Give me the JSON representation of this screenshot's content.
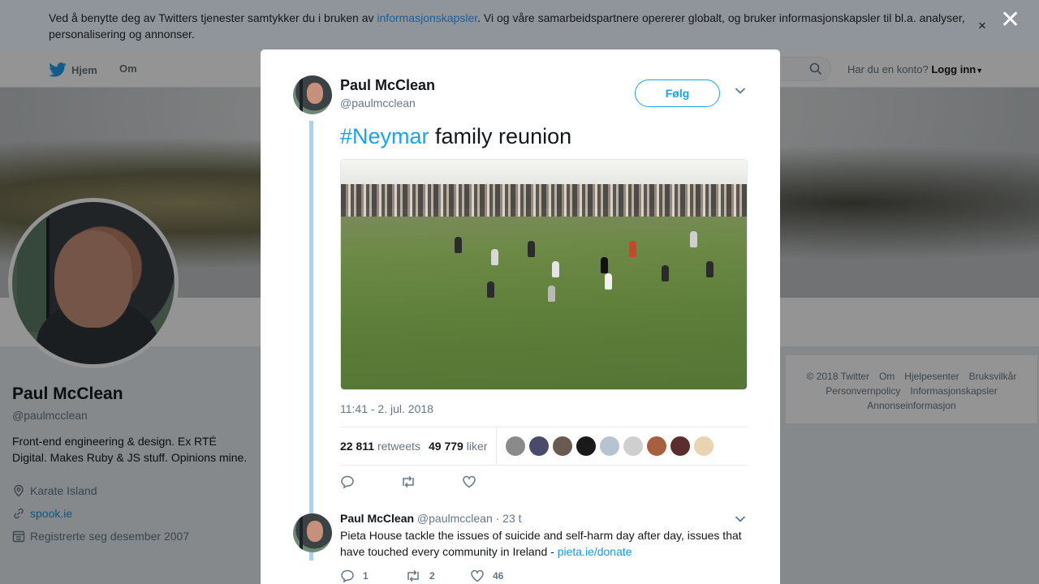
{
  "cookie": {
    "text_before": "Ved å benytte deg av Twitters tjenester samtykker du i bruken av ",
    "link": "informasjonskapsler",
    "text_after": ". Vi og våre samarbeidspartnere opererer globalt, og bruker informasjonskapsler til bl.a. analyser, personalisering og annonser.",
    "close_glyph": "×"
  },
  "overlay": {
    "close_glyph": "✕"
  },
  "nav": {
    "home": "Hjem",
    "about": "Om",
    "account_prompt": "Har du en konto?",
    "login": "Logg inn"
  },
  "profile": {
    "name": "Paul McClean",
    "handle": "@paulmcclean",
    "bio": "Front-end engineering & design. Ex RTÉ Digital. Makes Ruby & JS stuff. Opinions mine.",
    "location": "Karate Island",
    "website": "spook.ie",
    "joined": "Registrerte seg desember 2007"
  },
  "footer": {
    "items": [
      "© 2018 Twitter",
      "Om",
      "Hjelpesenter",
      "Bruksvilkår",
      "Personvernpolicy",
      "Informasjonskapsler",
      "Annonseinformasjon"
    ]
  },
  "tweet": {
    "name": "Paul McClean",
    "handle": "@paulmcclean",
    "follow_label": "Følg",
    "hashtag": "#Neymar",
    "text": " family reunion",
    "timestamp": "11:41 - 2. jul. 2018",
    "retweets_count": "22 811",
    "retweets_label": "retweets",
    "likes_count": "49 779",
    "likes_label": "liker",
    "liker_colors": [
      "#8a8a8a",
      "#4a4a6a",
      "#6b5a52",
      "#1a1a1a",
      "#b7c4cf",
      "#cfcfcf",
      "#a85f3d",
      "#5b2d2d",
      "#e8d4b0"
    ]
  },
  "reply": {
    "name": "Paul McClean",
    "handle": "@paulmcclean",
    "time": "· 23 t",
    "text": "Pieta House tackle the issues of suicide and self-harm day after day, issues that have touched every community in Ireland - ",
    "link": "pieta.ie/donate",
    "reply_count": "1",
    "retweet_count": "2",
    "like_count": "46"
  }
}
